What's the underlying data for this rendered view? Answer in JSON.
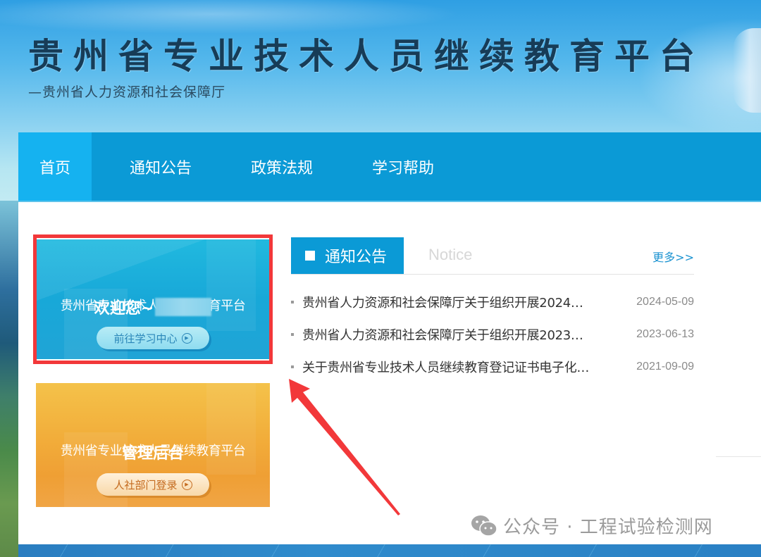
{
  "header": {
    "site_title": "贵州省专业技术人员继续教育平台",
    "site_subtitle": "—贵州省人力资源和社会保障厅"
  },
  "nav": {
    "items": [
      {
        "label": "首页",
        "active": true
      },
      {
        "label": "通知公告",
        "active": false
      },
      {
        "label": "政策法规",
        "active": false
      },
      {
        "label": "学习帮助",
        "active": false
      }
    ]
  },
  "cards": {
    "learner": {
      "title": "贵州省专业技术人员继续教育平台",
      "welcome": "欢迎您~",
      "button_label": "前往学习中心",
      "button_icon": "play-circle-icon"
    },
    "admin": {
      "title": "贵州省专业技术人员继续教育平台",
      "heading": "管理后台",
      "button_label": "人社部门登录",
      "button_icon": "play-circle-icon"
    }
  },
  "notice": {
    "tab_label": "通知公告",
    "tab_en": "Notice",
    "more_label": "更多>>",
    "items": [
      {
        "title": "贵州省人力资源和社会保障厅关于组织开展2024…",
        "date": "2024-05-09"
      },
      {
        "title": "贵州省人力资源和社会保障厅关于组织开展2023…",
        "date": "2023-06-13"
      },
      {
        "title": "关于贵州省专业技术人员继续教育登记证书电子化…",
        "date": "2021-09-09"
      }
    ]
  },
  "annotation": {
    "highlight_color": "#f2383a"
  },
  "watermark": {
    "text": "公众号 · 工程试验检测网"
  },
  "colors": {
    "nav_bg": "#0b9ad6",
    "nav_active": "#15b2f0",
    "card_blue": "#18a8d8",
    "card_orange": "#f2ad3a",
    "link": "#1c93d1"
  }
}
